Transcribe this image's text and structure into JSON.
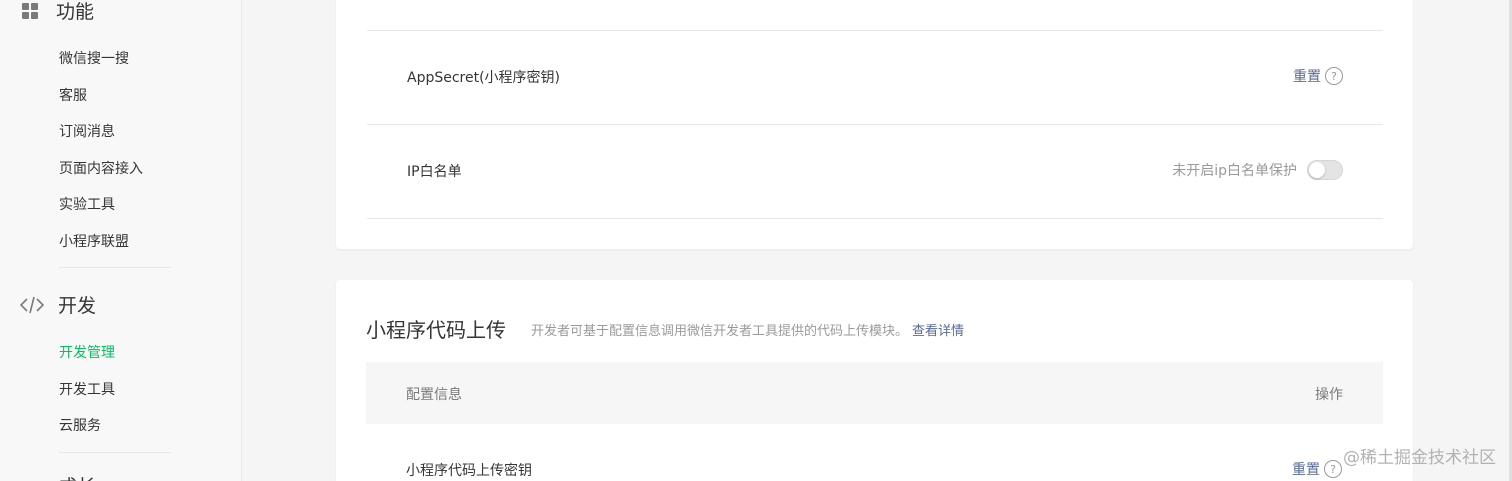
{
  "sidebar": {
    "section_function": {
      "icon": "grid-icon",
      "title": "功能"
    },
    "function_items": [
      "微信搜一搜",
      "客服",
      "订阅消息",
      "页面内容接入",
      "实验工具",
      "小程序联盟"
    ],
    "section_dev": {
      "icon": "code-icon",
      "title": "开发"
    },
    "dev_items": [
      "开发管理",
      "开发工具",
      "云服务"
    ],
    "active_item": "开发管理",
    "partial_next": "成长"
  },
  "top_card": {
    "rows": [
      {
        "label": "AppSecret(小程序密钥)",
        "action_link": "重置",
        "help": "?"
      },
      {
        "label": "IP白名单",
        "status_text": "未开启ip白名单保护",
        "toggle_on": false
      }
    ]
  },
  "upload_card": {
    "title": "小程序代码上传",
    "description": "开发者可基于配置信息调用微信开发者工具提供的代码上传模块。",
    "details_link": "查看详情",
    "table_headers": {
      "config": "配置信息",
      "action": "操作"
    },
    "rows": [
      {
        "label": "小程序代码上传密钥",
        "action_link": "重置",
        "help": "?"
      }
    ]
  },
  "watermark": "@稀土掘金技术社区"
}
